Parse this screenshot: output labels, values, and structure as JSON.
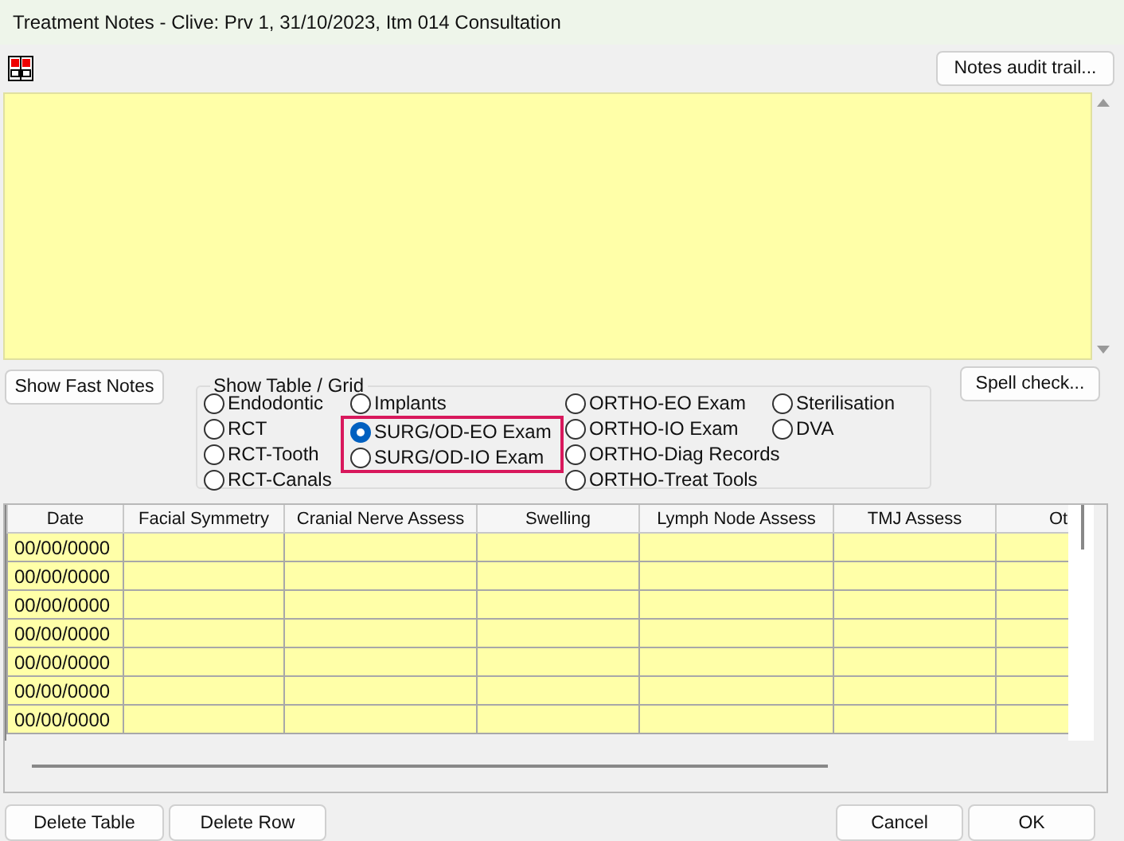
{
  "window": {
    "title": "Treatment Notes - Clive: Prv 1, 31/10/2023, Itm 014 Consultation"
  },
  "toolbar": {
    "audit_button": "Notes audit trail..."
  },
  "side_buttons": {
    "fast_notes": "Show Fast Notes",
    "spell_check": "Spell check..."
  },
  "grid_selector": {
    "title": "Show Table / Grid",
    "columns": [
      [
        {
          "label": "Endodontic",
          "selected": false,
          "highlighted": false
        },
        {
          "label": "RCT",
          "selected": false,
          "highlighted": false
        },
        {
          "label": "RCT-Tooth",
          "selected": false,
          "highlighted": false
        },
        {
          "label": "RCT-Canals",
          "selected": false,
          "highlighted": false
        }
      ],
      [
        {
          "label": "Implants",
          "selected": false,
          "highlighted": false
        },
        {
          "label": "SURG/OD-EO Exam",
          "selected": true,
          "highlighted": true
        },
        {
          "label": "SURG/OD-IO Exam",
          "selected": false,
          "highlighted": true
        }
      ],
      [
        {
          "label": "ORTHO-EO Exam",
          "selected": false,
          "highlighted": false
        },
        {
          "label": "ORTHO-IO Exam",
          "selected": false,
          "highlighted": false
        },
        {
          "label": "ORTHO-Diag Records",
          "selected": false,
          "highlighted": false
        },
        {
          "label": "ORTHO-Treat Tools",
          "selected": false,
          "highlighted": false
        }
      ],
      [
        {
          "label": "Sterilisation",
          "selected": false,
          "highlighted": false
        },
        {
          "label": "DVA",
          "selected": false,
          "highlighted": false
        }
      ]
    ]
  },
  "table": {
    "columns": [
      "Date",
      "Facial Symmetry",
      "Cranial Nerve Assess",
      "Swelling",
      "Lymph Node Assess",
      "TMJ Assess",
      "Ot"
    ],
    "rows": [
      {
        "date": "00/00/0000"
      },
      {
        "date": "00/00/0000"
      },
      {
        "date": "00/00/0000"
      },
      {
        "date": "00/00/0000"
      },
      {
        "date": "00/00/0000"
      },
      {
        "date": "00/00/0000"
      },
      {
        "date": "00/00/0000"
      }
    ]
  },
  "footer": {
    "left_buttons": [
      "Delete Table",
      "Delete Row"
    ],
    "right_buttons": [
      "Cancel",
      "OK"
    ]
  }
}
